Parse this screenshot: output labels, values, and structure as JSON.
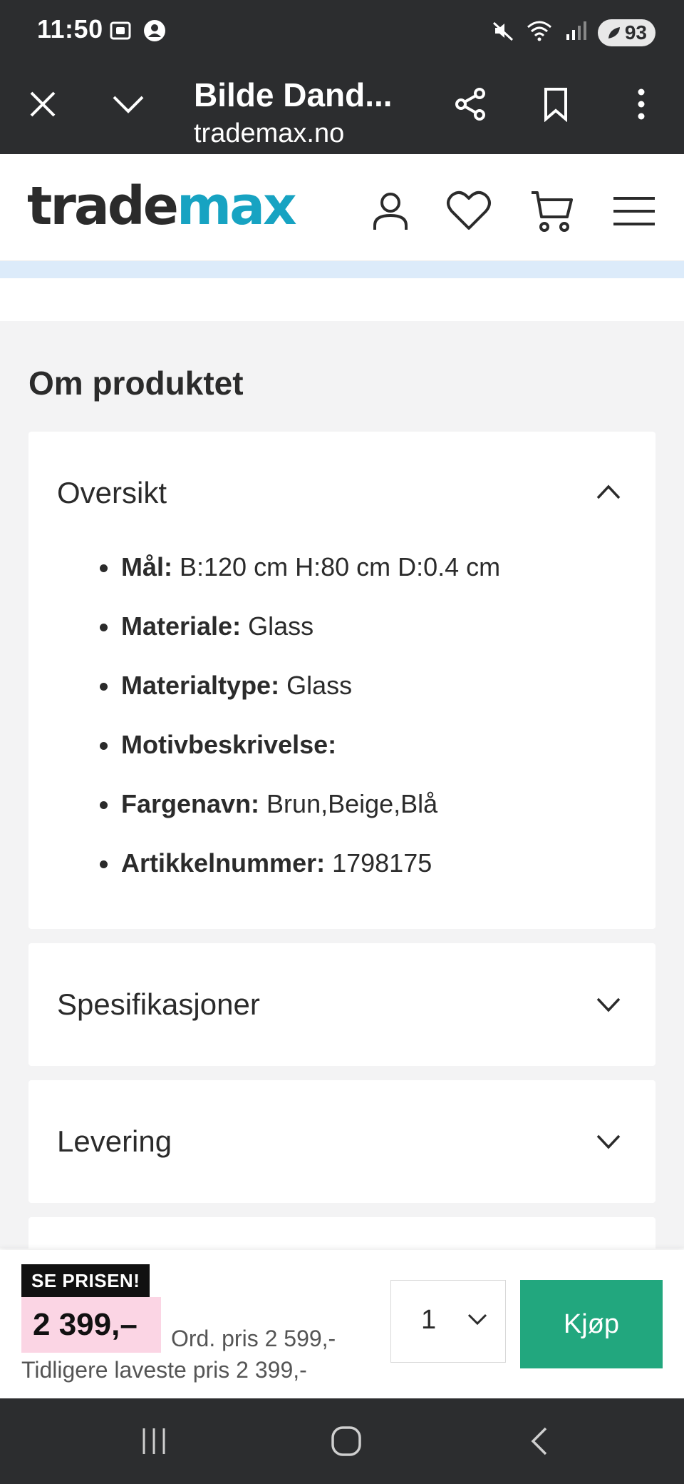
{
  "status_bar": {
    "time": "11:50",
    "battery": "93",
    "icons": [
      "screenshot-icon",
      "account-icon",
      "mute-icon",
      "wifi-icon",
      "signal-icon",
      "battery-icon"
    ]
  },
  "browser": {
    "title": "Bilde Dand...",
    "url": "trademax.no",
    "icons": [
      "close-icon",
      "chevron-down-icon",
      "share-icon",
      "bookmark-icon",
      "more-vert-icon"
    ]
  },
  "site": {
    "logo_part1": "trade",
    "logo_part2": "max",
    "brand_colors": {
      "dark": "#2b2b2b",
      "accent": "#17a3c2"
    },
    "icons": [
      "account-icon",
      "heart-icon",
      "cart-icon",
      "menu-icon"
    ]
  },
  "about": {
    "section_title": "Om produktet",
    "overview": {
      "title": "Oversikt",
      "expanded": true,
      "items": [
        {
          "key": "Mål:",
          "value": " B:120 cm H:80 cm D:0.4 cm"
        },
        {
          "key": "Materiale:",
          "value": " Glass"
        },
        {
          "key": "Materialtype:",
          "value": " Glass"
        },
        {
          "key": "Motivbeskrivelse:",
          "value": ""
        },
        {
          "key": "Fargenavn:",
          "value": " Brun,Beige,Blå"
        },
        {
          "key": "Artikkelnummer:",
          "value": " 1798175"
        }
      ]
    },
    "specifications": {
      "title": "Spesifikasjoner",
      "expanded": false
    },
    "delivery": {
      "title": "Levering",
      "expanded": false
    }
  },
  "purchase": {
    "promo_label": "SE PRISEN!",
    "price": "2 399,–",
    "ordinary_price": "Ord. pris 2 599,-",
    "previous_lowest": "Tidligere laveste pris 2 399,-",
    "quantity": "1",
    "buy_label": "Kjøp",
    "colors": {
      "price_bg": "#fbd5e4",
      "buy_bg": "#22a77e"
    }
  },
  "nav": {
    "icons": [
      "recent-apps-icon",
      "home-icon",
      "back-icon"
    ]
  }
}
